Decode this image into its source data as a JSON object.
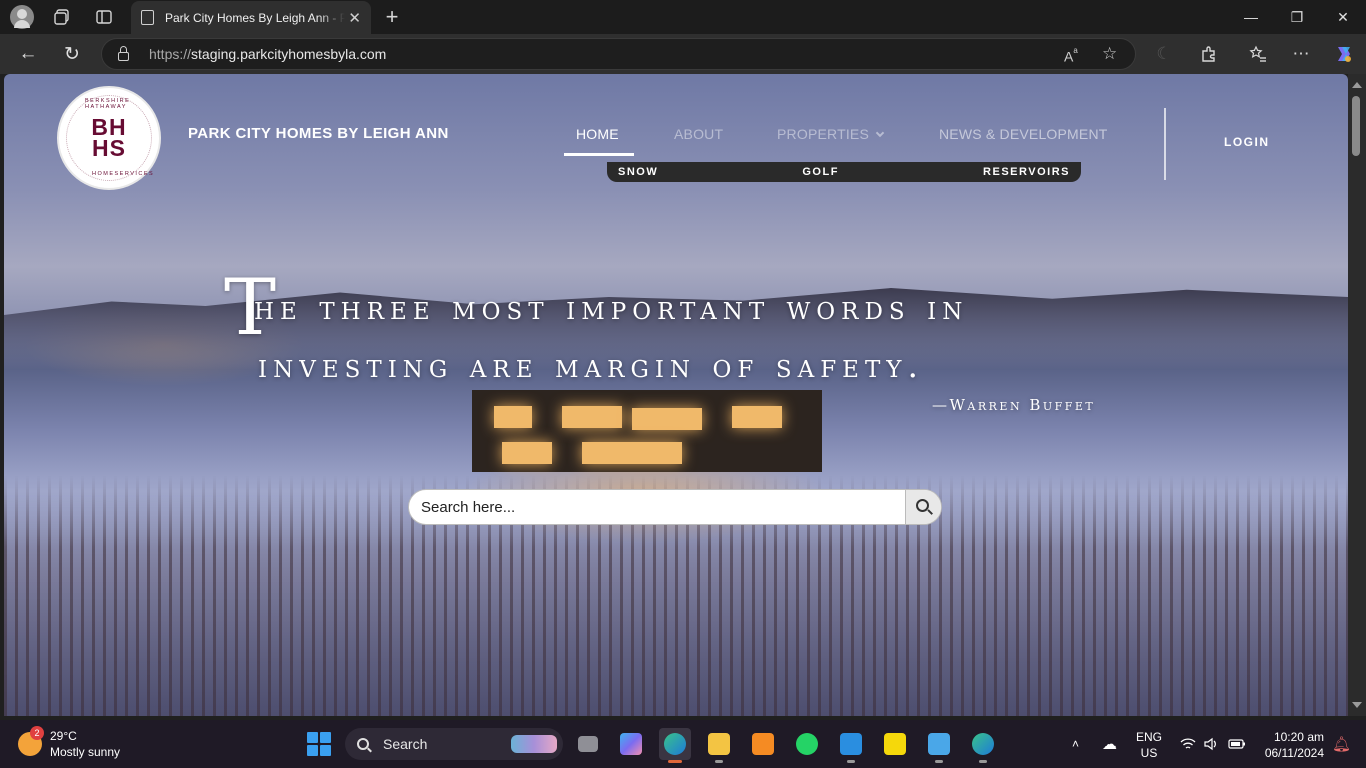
{
  "browser": {
    "tab_title": "Park City Homes By Leigh Ann - Park City",
    "url_protocol": "https://",
    "url_host": "staging.parkcityhomesbyla.com",
    "tab_close": "✕",
    "new_tab": "+",
    "window_minimize": "—",
    "window_maximize": "❐",
    "window_close": "✕",
    "back": "←",
    "refresh": "↻"
  },
  "site": {
    "title": "PARK CITY HOMES BY LEIGH ANN",
    "logo": {
      "monogram_top": "BH",
      "monogram_bottom": "HS",
      "arc_top": "BERKSHIRE HATHAWAY",
      "arc_bottom": "HOMESERVICES"
    },
    "nav": {
      "home": "HOME",
      "about": "ABOUT",
      "properties": "PROPERTIES",
      "news": "NEWS & DEVELOPMENT",
      "login": "LOGIN"
    },
    "submenu": [
      "SNOW",
      "GOLF",
      "RESERVOIRS"
    ]
  },
  "hero": {
    "quote_first_letter": "T",
    "quote_line1": "he three most important words in",
    "quote_line2": "investing are margin of safety.",
    "attribution": "—Warren Buffet",
    "search_placeholder": "Search here..."
  },
  "taskbar": {
    "weather_badge": "2",
    "temperature": "29°C",
    "condition": "Mostly sunny",
    "search_label": "Search",
    "lang_line1": "ENG",
    "lang_line2": "US",
    "time": "10:20 am",
    "date": "06/11/2024"
  },
  "colors": {
    "brand_maroon": "#670c33",
    "taskbar_bg": "#1f1a26",
    "chrome_bg": "#2f2f2f"
  }
}
